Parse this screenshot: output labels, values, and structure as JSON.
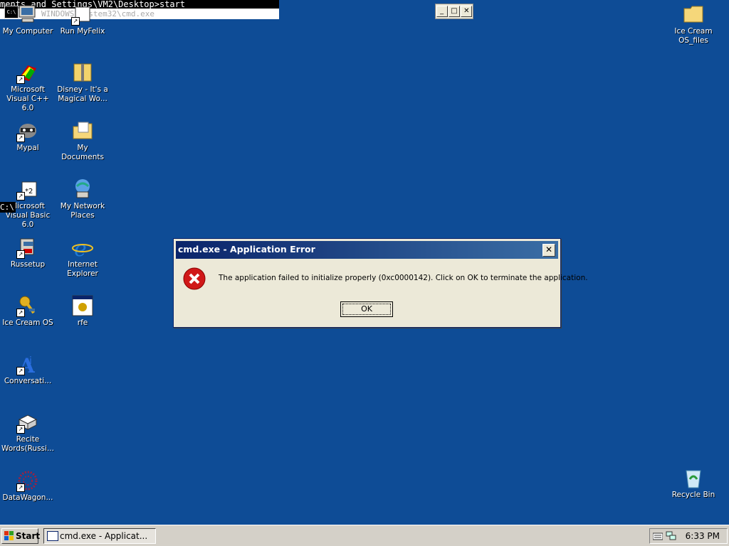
{
  "console": {
    "line1": "ments and Settings\\VM2\\Desktop>start",
    "line2": "WINDOWS\\system32\\cmd.exe",
    "app_icon": "C:\\",
    "fragment": "C:\\"
  },
  "float_controls": {
    "min": "_",
    "max": "□",
    "close": "✕"
  },
  "desktop_icons": [
    {
      "label": "My Computer",
      "icon": "computer-icon"
    },
    {
      "label": "Run MyFelix",
      "icon": "run-icon"
    },
    {
      "label": "Microsoft Visual C++ 6.0",
      "icon": "visual-cpp-icon"
    },
    {
      "label": "Disney - It's a Magical Wo...",
      "icon": "folder-zip-icon"
    },
    {
      "label": "Mypal",
      "icon": "raccoon-icon"
    },
    {
      "label": "My Documents",
      "icon": "documents-folder-icon"
    },
    {
      "label": "Microsoft Visual Basic 6.0",
      "icon": "visual-basic-icon"
    },
    {
      "label": "My Network Places",
      "icon": "network-places-icon"
    },
    {
      "label": "Russetup",
      "icon": "setup-icon"
    },
    {
      "label": "Internet Explorer",
      "icon": "internet-explorer-icon"
    },
    {
      "label": "Ice Cream OS",
      "icon": "key-icon"
    },
    {
      "label": "rfe",
      "icon": "app-window-icon"
    },
    {
      "label": "Conversati...",
      "icon": "conversation-icon"
    },
    {
      "label": "Recite Words(Russi...",
      "icon": "book-icon"
    },
    {
      "label": "DataWagon...",
      "icon": "datawagon-icon"
    },
    {
      "label": "Ice Cream OS_files",
      "icon": "folder-icon"
    },
    {
      "label": "Recycle Bin",
      "icon": "recycle-bin-icon"
    }
  ],
  "dialog": {
    "title": "cmd.exe - Application Error",
    "message": "The application failed to initialize properly (0xc0000142). Click on OK to terminate the application.",
    "ok_label": "OK",
    "close_label": "✕"
  },
  "taskbar": {
    "start_label": "Start",
    "task_label": "cmd.exe - Applicat...",
    "clock": "6:33 PM"
  }
}
